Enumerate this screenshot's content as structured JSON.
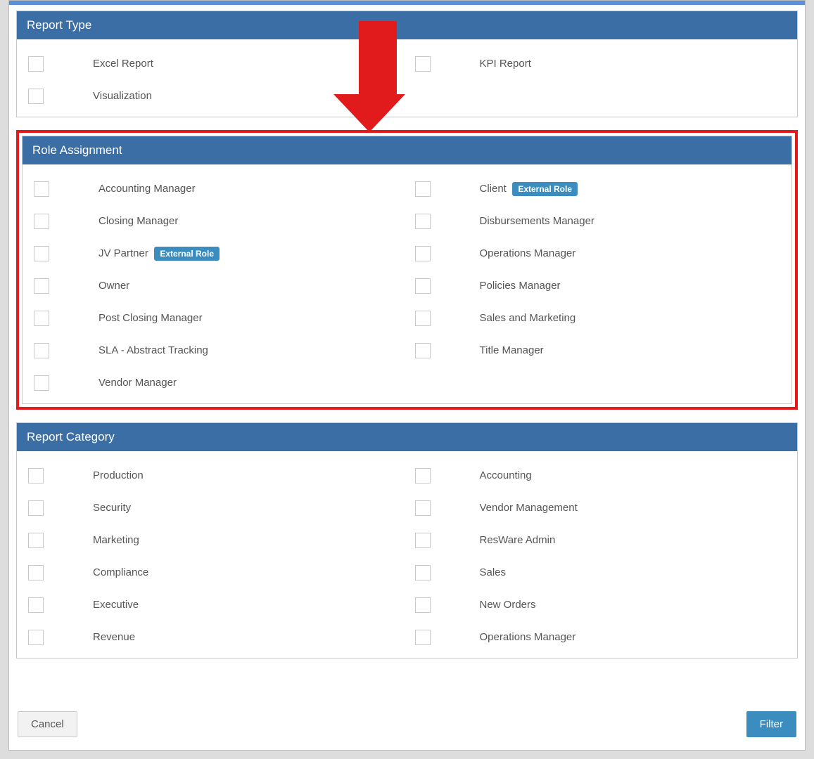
{
  "sections": {
    "report_type": {
      "title": "Report Type",
      "options": [
        {
          "label": "Excel Report",
          "badge": null
        },
        {
          "label": "KPI Report",
          "badge": null
        },
        {
          "label": "Visualization",
          "badge": null
        }
      ]
    },
    "role_assignment": {
      "title": "Role Assignment",
      "options": [
        {
          "label": "Accounting Manager",
          "badge": null
        },
        {
          "label": "Client",
          "badge": "External Role"
        },
        {
          "label": "Closing Manager",
          "badge": null
        },
        {
          "label": "Disbursements Manager",
          "badge": null
        },
        {
          "label": "JV Partner",
          "badge": "External Role"
        },
        {
          "label": "Operations Manager",
          "badge": null
        },
        {
          "label": "Owner",
          "badge": null
        },
        {
          "label": "Policies Manager",
          "badge": null
        },
        {
          "label": "Post Closing Manager",
          "badge": null
        },
        {
          "label": "Sales and Marketing",
          "badge": null
        },
        {
          "label": "SLA - Abstract Tracking",
          "badge": null
        },
        {
          "label": "Title Manager",
          "badge": null
        },
        {
          "label": "Vendor Manager",
          "badge": null
        }
      ]
    },
    "report_category": {
      "title": "Report Category",
      "options": [
        {
          "label": "Production",
          "badge": null
        },
        {
          "label": "Accounting",
          "badge": null
        },
        {
          "label": "Security",
          "badge": null
        },
        {
          "label": "Vendor Management",
          "badge": null
        },
        {
          "label": "Marketing",
          "badge": null
        },
        {
          "label": "ResWare Admin",
          "badge": null
        },
        {
          "label": "Compliance",
          "badge": null
        },
        {
          "label": "Sales",
          "badge": null
        },
        {
          "label": "Executive",
          "badge": null
        },
        {
          "label": "New Orders",
          "badge": null
        },
        {
          "label": "Revenue",
          "badge": null
        },
        {
          "label": "Operations Manager",
          "badge": null
        }
      ]
    }
  },
  "footer": {
    "cancel": "Cancel",
    "filter": "Filter"
  },
  "annotation": {
    "highlight_section": "role_assignment"
  }
}
